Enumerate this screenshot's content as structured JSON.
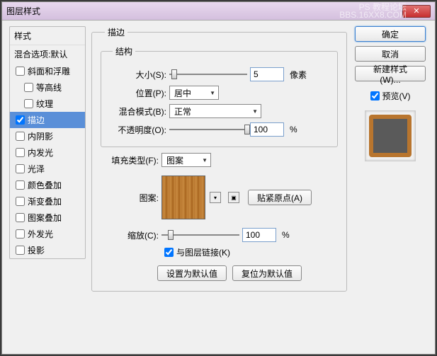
{
  "window": {
    "title": "图层样式"
  },
  "watermark": {
    "line1": "PS 教程论坛",
    "line2": "BBS.16XX8.COM"
  },
  "left": {
    "header": "样式",
    "blend": "混合选项:默认",
    "items": [
      {
        "label": "斜面和浮雕",
        "checked": false,
        "sub": false
      },
      {
        "label": "等高线",
        "checked": false,
        "sub": true
      },
      {
        "label": "纹理",
        "checked": false,
        "sub": true
      },
      {
        "label": "描边",
        "checked": true,
        "sub": false,
        "selected": true
      },
      {
        "label": "内阴影",
        "checked": false,
        "sub": false
      },
      {
        "label": "内发光",
        "checked": false,
        "sub": false
      },
      {
        "label": "光泽",
        "checked": false,
        "sub": false
      },
      {
        "label": "颜色叠加",
        "checked": false,
        "sub": false
      },
      {
        "label": "渐变叠加",
        "checked": false,
        "sub": false
      },
      {
        "label": "图案叠加",
        "checked": false,
        "sub": false
      },
      {
        "label": "外发光",
        "checked": false,
        "sub": false
      },
      {
        "label": "投影",
        "checked": false,
        "sub": false
      }
    ]
  },
  "stroke": {
    "title": "描边",
    "structure": {
      "title": "结构",
      "size_label": "大小(S):",
      "size_value": "5",
      "size_unit": "像素",
      "position_label": "位置(P):",
      "position_value": "居中",
      "blend_label": "混合模式(B):",
      "blend_value": "正常",
      "opacity_label": "不透明度(O):",
      "opacity_value": "100",
      "opacity_unit": "%"
    },
    "fill": {
      "type_label": "填充类型(F):",
      "type_value": "图案",
      "pattern_label": "图案:",
      "snap_label": "贴紧原点(A)",
      "scale_label": "缩放(C):",
      "scale_value": "100",
      "scale_unit": "%",
      "link_label": "与图层链接(K)",
      "link_checked": true
    },
    "buttons": {
      "default": "设置为默认值",
      "reset": "复位为默认值"
    }
  },
  "right": {
    "ok": "确定",
    "cancel": "取消",
    "new_style": "新建样式(W)...",
    "preview_label": "预览(V)",
    "preview_checked": true
  }
}
